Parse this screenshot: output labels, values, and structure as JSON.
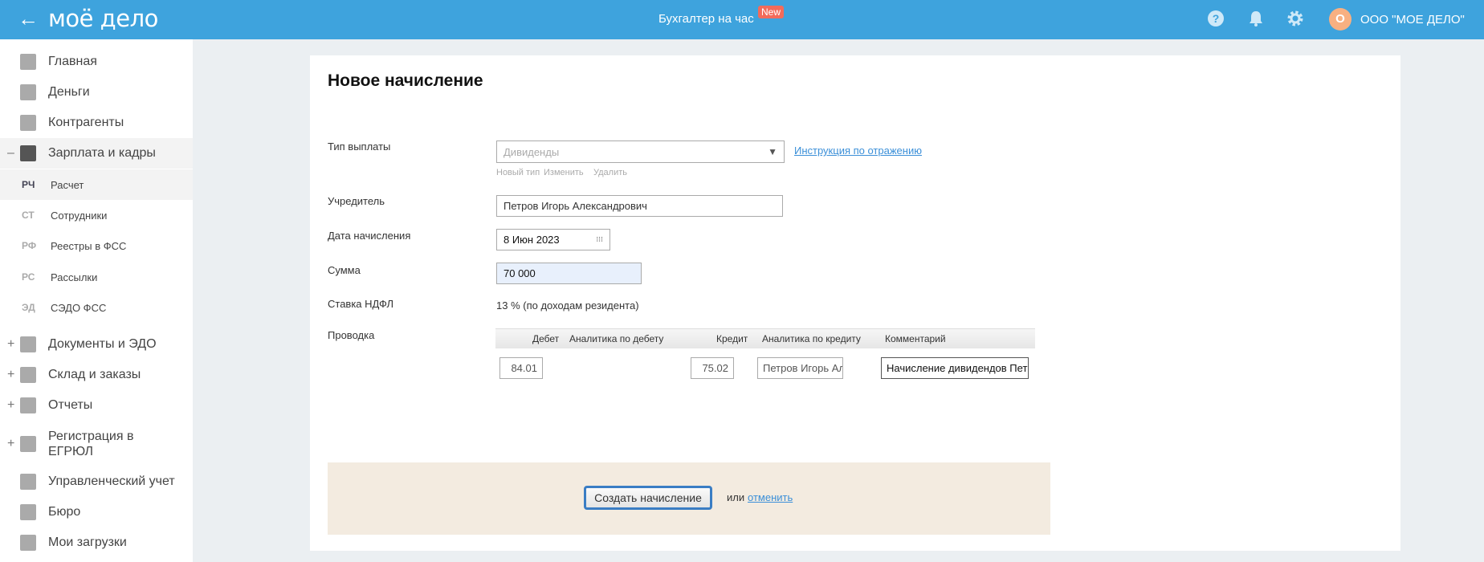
{
  "header": {
    "logo": "моё дело",
    "service": "Бухгалтер на час",
    "badge": "New",
    "avatar_letter": "О",
    "org": "ООО \"МОЕ ДЕЛО\""
  },
  "sidebar": {
    "items": [
      {
        "label": "Главная"
      },
      {
        "label": "Деньги"
      },
      {
        "label": "Контрагенты"
      },
      {
        "label": "Зарплата и кадры",
        "toggle": "–"
      },
      {
        "label": "Документы и ЭДО",
        "toggle": "+"
      },
      {
        "label": "Склад и заказы",
        "toggle": "+"
      },
      {
        "label": "Отчеты",
        "toggle": "+"
      },
      {
        "label": "Регистрация в ЕГРЮЛ",
        "toggle": "+"
      },
      {
        "label": "Управленческий учет"
      },
      {
        "label": "Бюро"
      },
      {
        "label": "Мои загрузки"
      }
    ],
    "subitems": [
      {
        "abbr": "РЧ",
        "label": "Расчет"
      },
      {
        "abbr": "СТ",
        "label": "Сотрудники"
      },
      {
        "abbr": "РФ",
        "label": "Реестры в ФСС"
      },
      {
        "abbr": "РС",
        "label": "Рассылки"
      },
      {
        "abbr": "ЭД",
        "label": "СЭДО ФСС"
      }
    ]
  },
  "form": {
    "title": "Новое начисление",
    "type_label": "Тип выплаты",
    "type_value": "Дивиденды",
    "instruction_link": "Инструкция по отражению",
    "type_actions": [
      "Новый тип",
      "Изменить",
      "Удалить"
    ],
    "founder_label": "Учредитель",
    "founder_value": "Петров Игорь Александрович",
    "date_label": "Дата начисления",
    "date_value": "8 Июн 2023",
    "sum_label": "Сумма",
    "sum_value": "70 000",
    "rate_label": "Ставка НДФЛ",
    "rate_value": "13 % (по доходам резидента)",
    "posting_label": "Проводка",
    "table": {
      "headers": [
        "Дебет",
        "Аналитика по дебету",
        "Кредит",
        "Аналитика по кредиту",
        "Комментарий"
      ],
      "row": {
        "debit": "84.01",
        "credit": "75.02",
        "credit_analytics": "Петров Игорь Александрович",
        "comment": "Начисление дивидендов Петрову И. А."
      }
    }
  },
  "footer": {
    "submit": "Создать начисление",
    "or": "или",
    "cancel": "отменить"
  }
}
